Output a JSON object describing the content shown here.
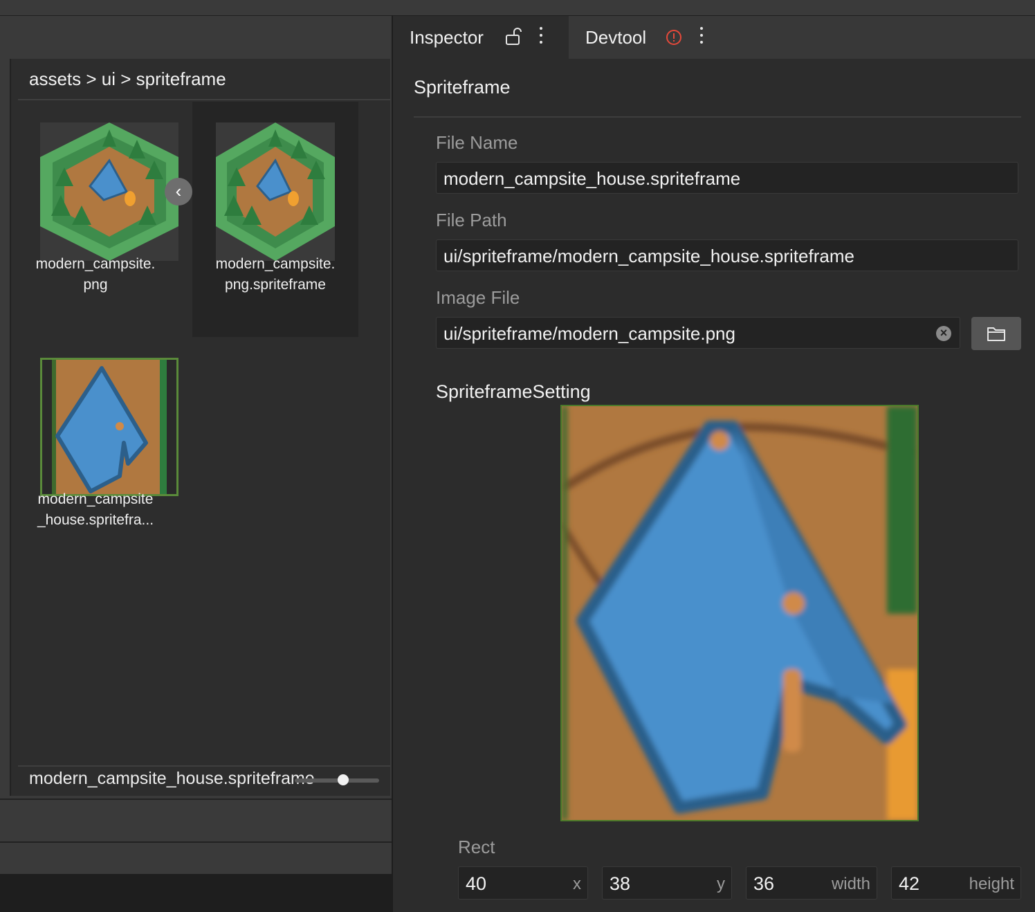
{
  "assets_panel": {
    "breadcrumb": "assets > ui > spriteframe",
    "items": [
      {
        "label_line1": "modern_campsite.",
        "label_line2": "png",
        "icon": "image-thumbnail"
      },
      {
        "label_line1": "modern_campsite.",
        "label_line2": "png.spriteframe",
        "icon": "image-thumbnail"
      },
      {
        "label_line1": "modern_campsite",
        "label_line2": "_house.spritefra...",
        "icon": "spriteframe-thumbnail",
        "selected": true
      }
    ],
    "selected_name": "modern_campsite_house.spriteframe",
    "nav_glyph": "‹",
    "zoom_slider_value": 0.6
  },
  "inspector": {
    "tabs": [
      {
        "label": "Inspector",
        "icon": "unlock-icon",
        "active": true
      },
      {
        "label": "Devtool",
        "icon": "warning-circle-icon",
        "active": false
      }
    ],
    "section_title": "Spriteframe",
    "file_name_label": "File Name",
    "file_name_value": "modern_campsite_house.spriteframe",
    "file_path_label": "File Path",
    "file_path_value": "ui/spriteframe/modern_campsite_house.spriteframe",
    "image_file_label": "Image File",
    "image_file_value": "ui/spriteframe/modern_campsite.png",
    "clear_glyph": "×",
    "setting_title": "SpriteframeSetting",
    "rect_label": "Rect",
    "rect": [
      {
        "value": "40",
        "unit": "x"
      },
      {
        "value": "38",
        "unit": "y"
      },
      {
        "value": "36",
        "unit": "width"
      },
      {
        "value": "42",
        "unit": "height"
      }
    ]
  },
  "colors": {
    "accent_green": "#4a7a2a",
    "warning_red": "#e5493a",
    "tent_blue": "#4a90cc",
    "ground_brown": "#b07840"
  }
}
